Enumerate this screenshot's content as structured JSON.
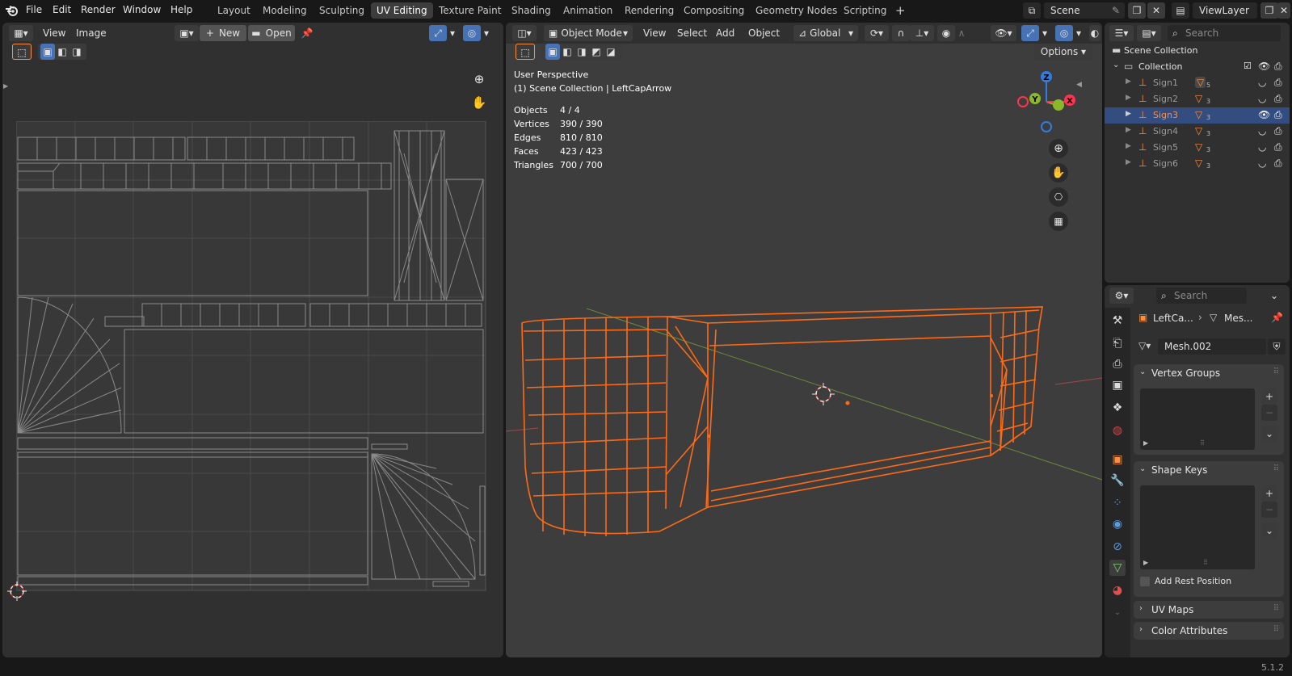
{
  "topbar": {
    "menus": [
      "File",
      "Edit",
      "Render",
      "Window",
      "Help"
    ],
    "workspaces": [
      "Layout",
      "Modeling",
      "Sculpting",
      "UV Editing",
      "Texture Paint",
      "Shading",
      "Animation",
      "Rendering",
      "Compositing",
      "Geometry Nodes",
      "Scripting"
    ],
    "active_workspace": "UV Editing",
    "add_tab": "+",
    "scene_label": "Scene",
    "view_layer_label": "ViewLayer"
  },
  "uv_editor": {
    "menus": [
      "View",
      "Image"
    ],
    "new_label": "New",
    "open_label": "Open"
  },
  "viewport": {
    "mode_label": "Object Mode",
    "menus": [
      "View",
      "Select",
      "Add",
      "Object"
    ],
    "orientation_label": "Global",
    "options_label": "Options",
    "overlay_title": "User Perspective",
    "overlay_subtitle": "(1) Scene Collection | LeftCapArrow",
    "stats": [
      {
        "label": "Objects",
        "value": "4 / 4"
      },
      {
        "label": "Vertices",
        "value": "390 / 390"
      },
      {
        "label": "Edges",
        "value": "810 / 810"
      },
      {
        "label": "Faces",
        "value": "423 / 423"
      },
      {
        "label": "Triangles",
        "value": "700 / 700"
      }
    ],
    "gizmo": {
      "z": "Z",
      "y": "Y",
      "x": "X"
    }
  },
  "outliner": {
    "search_placeholder": "Search",
    "scene_collection": "Scene Collection",
    "collection": "Collection",
    "items": [
      {
        "name": "Sign1",
        "count": "5"
      },
      {
        "name": "Sign2",
        "count": "3"
      },
      {
        "name": "Sign3",
        "count": "3"
      },
      {
        "name": "Sign4",
        "count": "3"
      },
      {
        "name": "Sign5",
        "count": "3"
      },
      {
        "name": "Sign6",
        "count": "3"
      }
    ],
    "selected": "Sign3"
  },
  "properties": {
    "search_placeholder": "Search",
    "breadcrumb_object": "LeftCa...",
    "breadcrumb_mesh": "Mes...",
    "mesh_name": "Mesh.002",
    "panels": {
      "vertex_groups": "Vertex Groups",
      "shape_keys": "Shape Keys",
      "add_rest_position": "Add Rest Position",
      "uv_maps": "UV Maps",
      "color_attributes": "Color Attributes"
    }
  },
  "statusbar": {
    "version": "5.1.2"
  },
  "colors": {
    "accent": "#4772b3",
    "selection": "#ff6a13",
    "background": "#181818",
    "area": "#303030"
  }
}
